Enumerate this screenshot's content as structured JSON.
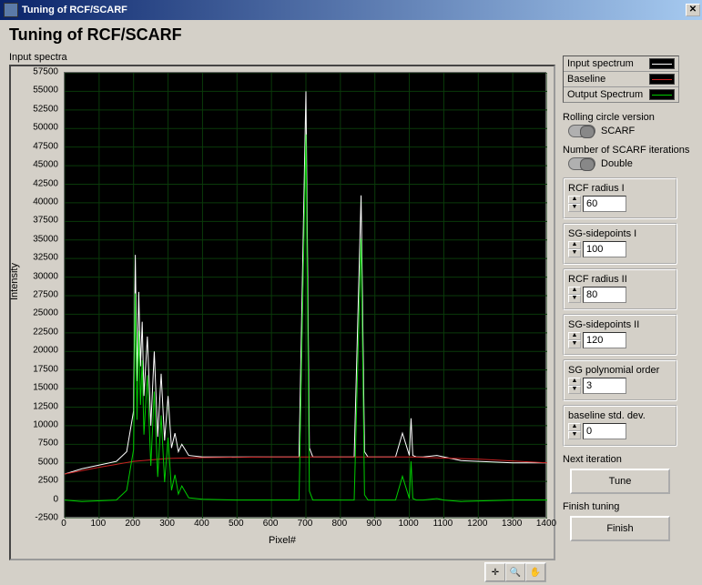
{
  "window": {
    "title": "Tuning of RCF/SCARF"
  },
  "header": {
    "title": "Tuning of RCF/SCARF"
  },
  "plot": {
    "label": "Input spectra",
    "xlabel": "Pixel#",
    "ylabel": "Intensity",
    "y_ticks": [
      -2500,
      0,
      2500,
      5000,
      7500,
      10000,
      12500,
      15000,
      17500,
      20000,
      22500,
      25000,
      27500,
      30000,
      32500,
      35000,
      37500,
      40000,
      42500,
      45000,
      47500,
      50000,
      52500,
      55000,
      57500
    ],
    "x_ticks": [
      0,
      100,
      200,
      300,
      400,
      500,
      600,
      700,
      800,
      900,
      1000,
      1100,
      1200,
      1300,
      1400
    ]
  },
  "legend": {
    "items": [
      {
        "label": "Input spectrum",
        "color": "#ffffff"
      },
      {
        "label": "Baseline",
        "color": "#cc2222"
      },
      {
        "label": "Output Spectrum",
        "color": "#00cc00"
      }
    ]
  },
  "controls": {
    "rcv": {
      "label": "Rolling circle version",
      "value": "SCARF"
    },
    "iter": {
      "label": "Number of SCARF iterations",
      "value": "Double"
    },
    "rcf1": {
      "label": "RCF radius I",
      "value": "60"
    },
    "sg1": {
      "label": "SG-sidepoints I",
      "value": "100"
    },
    "rcf2": {
      "label": "RCF radius II",
      "value": "80"
    },
    "sg2": {
      "label": "SG-sidepoints II",
      "value": "120"
    },
    "sgord": {
      "label": "SG polynomial order",
      "value": "3"
    },
    "bstd": {
      "label": "baseline std. dev.",
      "value": "0"
    },
    "next": {
      "label": "Next iteration",
      "button": "Tune"
    },
    "finish": {
      "label": "Finish tuning",
      "button": "Finish"
    }
  },
  "chart_data": {
    "type": "line",
    "xlabel": "Pixel#",
    "ylabel": "Intensity",
    "xlim": [
      0,
      1400
    ],
    "ylim": [
      -2500,
      57500
    ],
    "series": [
      {
        "name": "Input spectrum",
        "color": "#ffffff",
        "x": [
          0,
          50,
          150,
          180,
          200,
          205,
          210,
          215,
          220,
          225,
          230,
          240,
          250,
          260,
          270,
          280,
          290,
          300,
          310,
          320,
          330,
          340,
          360,
          400,
          500,
          600,
          680,
          700,
          710,
          720,
          740,
          780,
          840,
          860,
          870,
          880,
          900,
          960,
          980,
          1000,
          1005,
          1010,
          1020,
          1040,
          1080,
          1100,
          1150,
          1300,
          1400
        ],
        "y": [
          3500,
          4200,
          5200,
          6500,
          12000,
          33000,
          16000,
          28000,
          18000,
          24000,
          14000,
          22000,
          10000,
          20000,
          8500,
          17000,
          8000,
          14000,
          7000,
          9000,
          6500,
          7500,
          6000,
          5800,
          5800,
          5800,
          5800,
          55000,
          7000,
          5800,
          5800,
          5800,
          5800,
          41000,
          6500,
          5800,
          5800,
          5800,
          9000,
          6000,
          11000,
          6000,
          5800,
          5800,
          6000,
          5800,
          5300,
          5000,
          5000
        ]
      },
      {
        "name": "Baseline",
        "color": "#cc2222",
        "x": [
          0,
          100,
          200,
          300,
          400,
          600,
          800,
          1000,
          1200,
          1400
        ],
        "y": [
          3500,
          4400,
          5200,
          5600,
          5700,
          5800,
          5800,
          5800,
          5500,
          5000
        ]
      },
      {
        "name": "Output Spectrum",
        "color": "#00cc00",
        "x": [
          0,
          50,
          150,
          180,
          200,
          205,
          210,
          215,
          220,
          225,
          230,
          240,
          250,
          260,
          270,
          280,
          290,
          300,
          310,
          320,
          330,
          340,
          360,
          400,
          500,
          600,
          680,
          700,
          710,
          720,
          740,
          780,
          840,
          860,
          870,
          880,
          900,
          960,
          980,
          1000,
          1005,
          1010,
          1020,
          1040,
          1080,
          1100,
          1150,
          1300,
          1400
        ],
        "y": [
          0,
          -200,
          0,
          1300,
          6800,
          27800,
          10800,
          22800,
          12800,
          18800,
          8800,
          16800,
          4600,
          14600,
          3100,
          11400,
          2400,
          8400,
          1300,
          3400,
          800,
          1900,
          300,
          100,
          0,
          0,
          0,
          49200,
          1200,
          0,
          0,
          0,
          0,
          35200,
          700,
          0,
          0,
          0,
          3200,
          200,
          5200,
          200,
          0,
          0,
          200,
          0,
          -200,
          0,
          0
        ]
      }
    ]
  }
}
